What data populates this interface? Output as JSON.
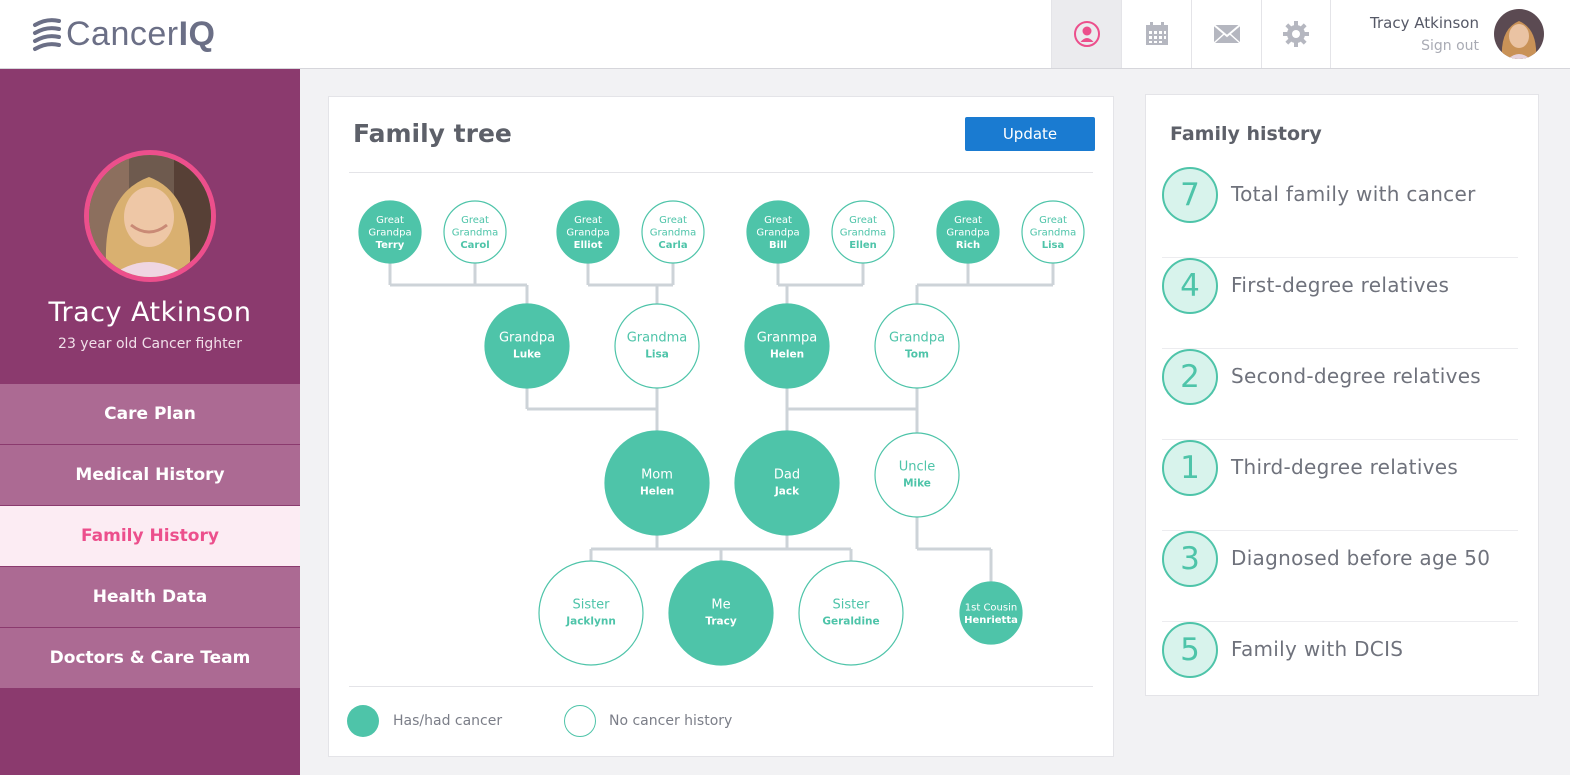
{
  "header": {
    "logo_text_light": "Cancer",
    "logo_text_bold": "IQ",
    "nav_icons": [
      "profile-icon",
      "calendar-icon",
      "mail-icon",
      "gear-icon"
    ],
    "user_name": "Tracy Atkinson",
    "signout": "Sign out"
  },
  "sidebar": {
    "name": "Tracy Atkinson",
    "subtitle": "23 year old Cancer fighter",
    "nav": [
      "Care Plan",
      "Medical History",
      "Family History",
      "Health Data",
      "Doctors & Care Team"
    ],
    "active_nav": "Family History"
  },
  "tree": {
    "title": "Family tree",
    "update_label": "Update",
    "nodes": [
      {
        "id": "gg-terry",
        "role": "Great Grandpa",
        "name": "Terry",
        "cancer": true
      },
      {
        "id": "gg-carol",
        "role": "Great Grandma",
        "name": "Carol",
        "cancer": false
      },
      {
        "id": "gg-elliot",
        "role": "Great Grandpa",
        "name": "Elliot",
        "cancer": true
      },
      {
        "id": "gg-carla",
        "role": "Great Grandma",
        "name": "Carla",
        "cancer": false
      },
      {
        "id": "gg-bill",
        "role": "Great Grandpa",
        "name": "Bill",
        "cancer": true
      },
      {
        "id": "gg-ellen",
        "role": "Great Grandma",
        "name": "Ellen",
        "cancer": false
      },
      {
        "id": "gg-rich",
        "role": "Great Grandpa",
        "name": "Rich",
        "cancer": true
      },
      {
        "id": "gg-lisa",
        "role": "Great Grandma",
        "name": "Lisa",
        "cancer": false
      },
      {
        "id": "g-luke",
        "role": "Grandpa",
        "name": "Luke",
        "cancer": true
      },
      {
        "id": "g-lisa",
        "role": "Grandma",
        "name": "Lisa",
        "cancer": false
      },
      {
        "id": "g-helen",
        "role": "Granmpa",
        "name": "Helen",
        "cancer": true
      },
      {
        "id": "g-tom",
        "role": "Grandpa",
        "name": "Tom",
        "cancer": false
      },
      {
        "id": "p-mom",
        "role": "Mom",
        "name": "Helen",
        "cancer": true
      },
      {
        "id": "p-dad",
        "role": "Dad",
        "name": "Jack",
        "cancer": true
      },
      {
        "id": "p-uncle",
        "role": "Uncle",
        "name": "Mike",
        "cancer": false
      },
      {
        "id": "c-jacklynn",
        "role": "Sister",
        "name": "Jacklynn",
        "cancer": false
      },
      {
        "id": "c-me",
        "role": "Me",
        "name": "Tracy",
        "cancer": true
      },
      {
        "id": "c-geraldine",
        "role": "Sister",
        "name": "Geraldine",
        "cancer": false
      },
      {
        "id": "c-henrietta",
        "role": "1st Cousin",
        "name": "Henrietta",
        "cancer": true
      }
    ],
    "legend": {
      "cancer": "Has/had cancer",
      "no_cancer": "No cancer history"
    }
  },
  "history": {
    "title": "Family history",
    "stats": [
      {
        "value": "7",
        "label": "Total family with cancer"
      },
      {
        "value": "4",
        "label": "First-degree relatives"
      },
      {
        "value": "2",
        "label": "Second-degree relatives"
      },
      {
        "value": "1",
        "label": "Third-degree relatives"
      },
      {
        "value": "3",
        "label": "Diagnosed before age 50"
      },
      {
        "value": "5",
        "label": "Family with DCIS"
      }
    ]
  },
  "colors": {
    "teal": "#4ec4a9",
    "sidebar": "#8b3a6e",
    "nav": "#ac6a93",
    "accent_pink": "#ec4f8c",
    "button_blue": "#1a7bd1"
  }
}
